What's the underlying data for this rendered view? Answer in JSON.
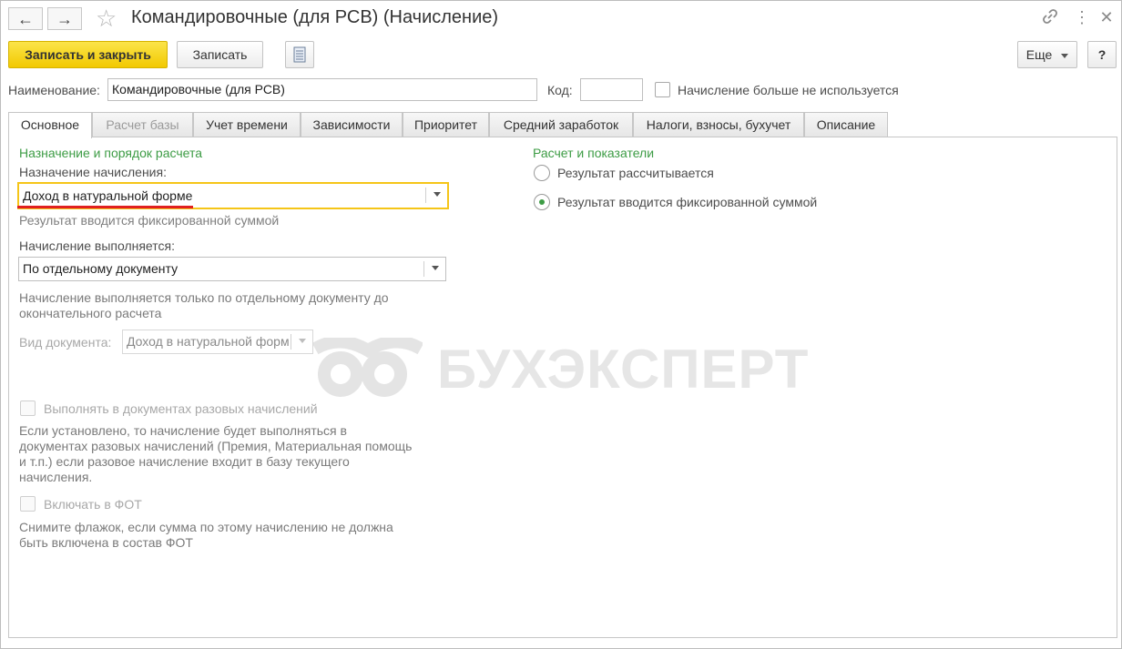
{
  "window": {
    "title": "Командировочные (для РСВ) (Начисление)",
    "back_icon": "←",
    "forward_icon": "→",
    "star_icon": "☆",
    "link_icon": "🔗",
    "menu_icon": "⋮",
    "close_icon": "✕"
  },
  "toolbar": {
    "save_close_label": "Записать и закрыть",
    "save_label": "Записать",
    "more_label": "Еще",
    "help_label": "?"
  },
  "header": {
    "name_label": "Наименование:",
    "name_value": "Командировочные (для РСВ)",
    "code_label": "Код:",
    "code_value": "",
    "not_used_label": "Начисление больше не используется"
  },
  "tabs": [
    {
      "label": "Основное"
    },
    {
      "label": "Расчет базы"
    },
    {
      "label": "Учет времени"
    },
    {
      "label": "Зависимости"
    },
    {
      "label": "Приоритет"
    },
    {
      "label": "Средний заработок"
    },
    {
      "label": "Налоги, взносы, бухучет"
    },
    {
      "label": "Описание"
    }
  ],
  "main": {
    "section_left_title": "Назначение и порядок расчета",
    "purpose_label": "Назначение начисления:",
    "purpose_value": "Доход в натуральной форме",
    "purpose_hint": "Результат вводится фиксированной суммой",
    "execution_label": "Начисление выполняется:",
    "execution_value": "По отдельному документу",
    "execution_hint_1": "Начисление выполняется только по отдельному документу до",
    "execution_hint_2": "окончательного расчета",
    "doc_type_label": "Вид документа:",
    "doc_type_value": "Доход в натуральной форм",
    "one_time_label": "Выполнять в документах разовых начислений",
    "one_time_hint_1": "Если установлено, то начисление будет выполняться в",
    "one_time_hint_2": "документах разовых начислений (Премия, Материальная помощь",
    "one_time_hint_3": "и т.п.) если разовое начисление входит в базу текущего",
    "one_time_hint_4": "начисления.",
    "fot_label": "Включать в ФОТ",
    "fot_hint_1": "Снимите флажок, если сумма по этому начислению не должна",
    "fot_hint_2": "быть включена в состав ФОТ",
    "section_right_title": "Расчет и показатели",
    "radio_calculated": "Результат рассчитывается",
    "radio_fixed": "Результат вводится фиксированной суммой",
    "radio_selected": "fixed"
  },
  "watermark": {
    "text": "БУХЭКСПЕРТ"
  },
  "colors": {
    "accent_green": "#3d9c45",
    "primary_button": "#f2c900",
    "focus_border": "#f5c518",
    "underline_red": "#e02020"
  }
}
